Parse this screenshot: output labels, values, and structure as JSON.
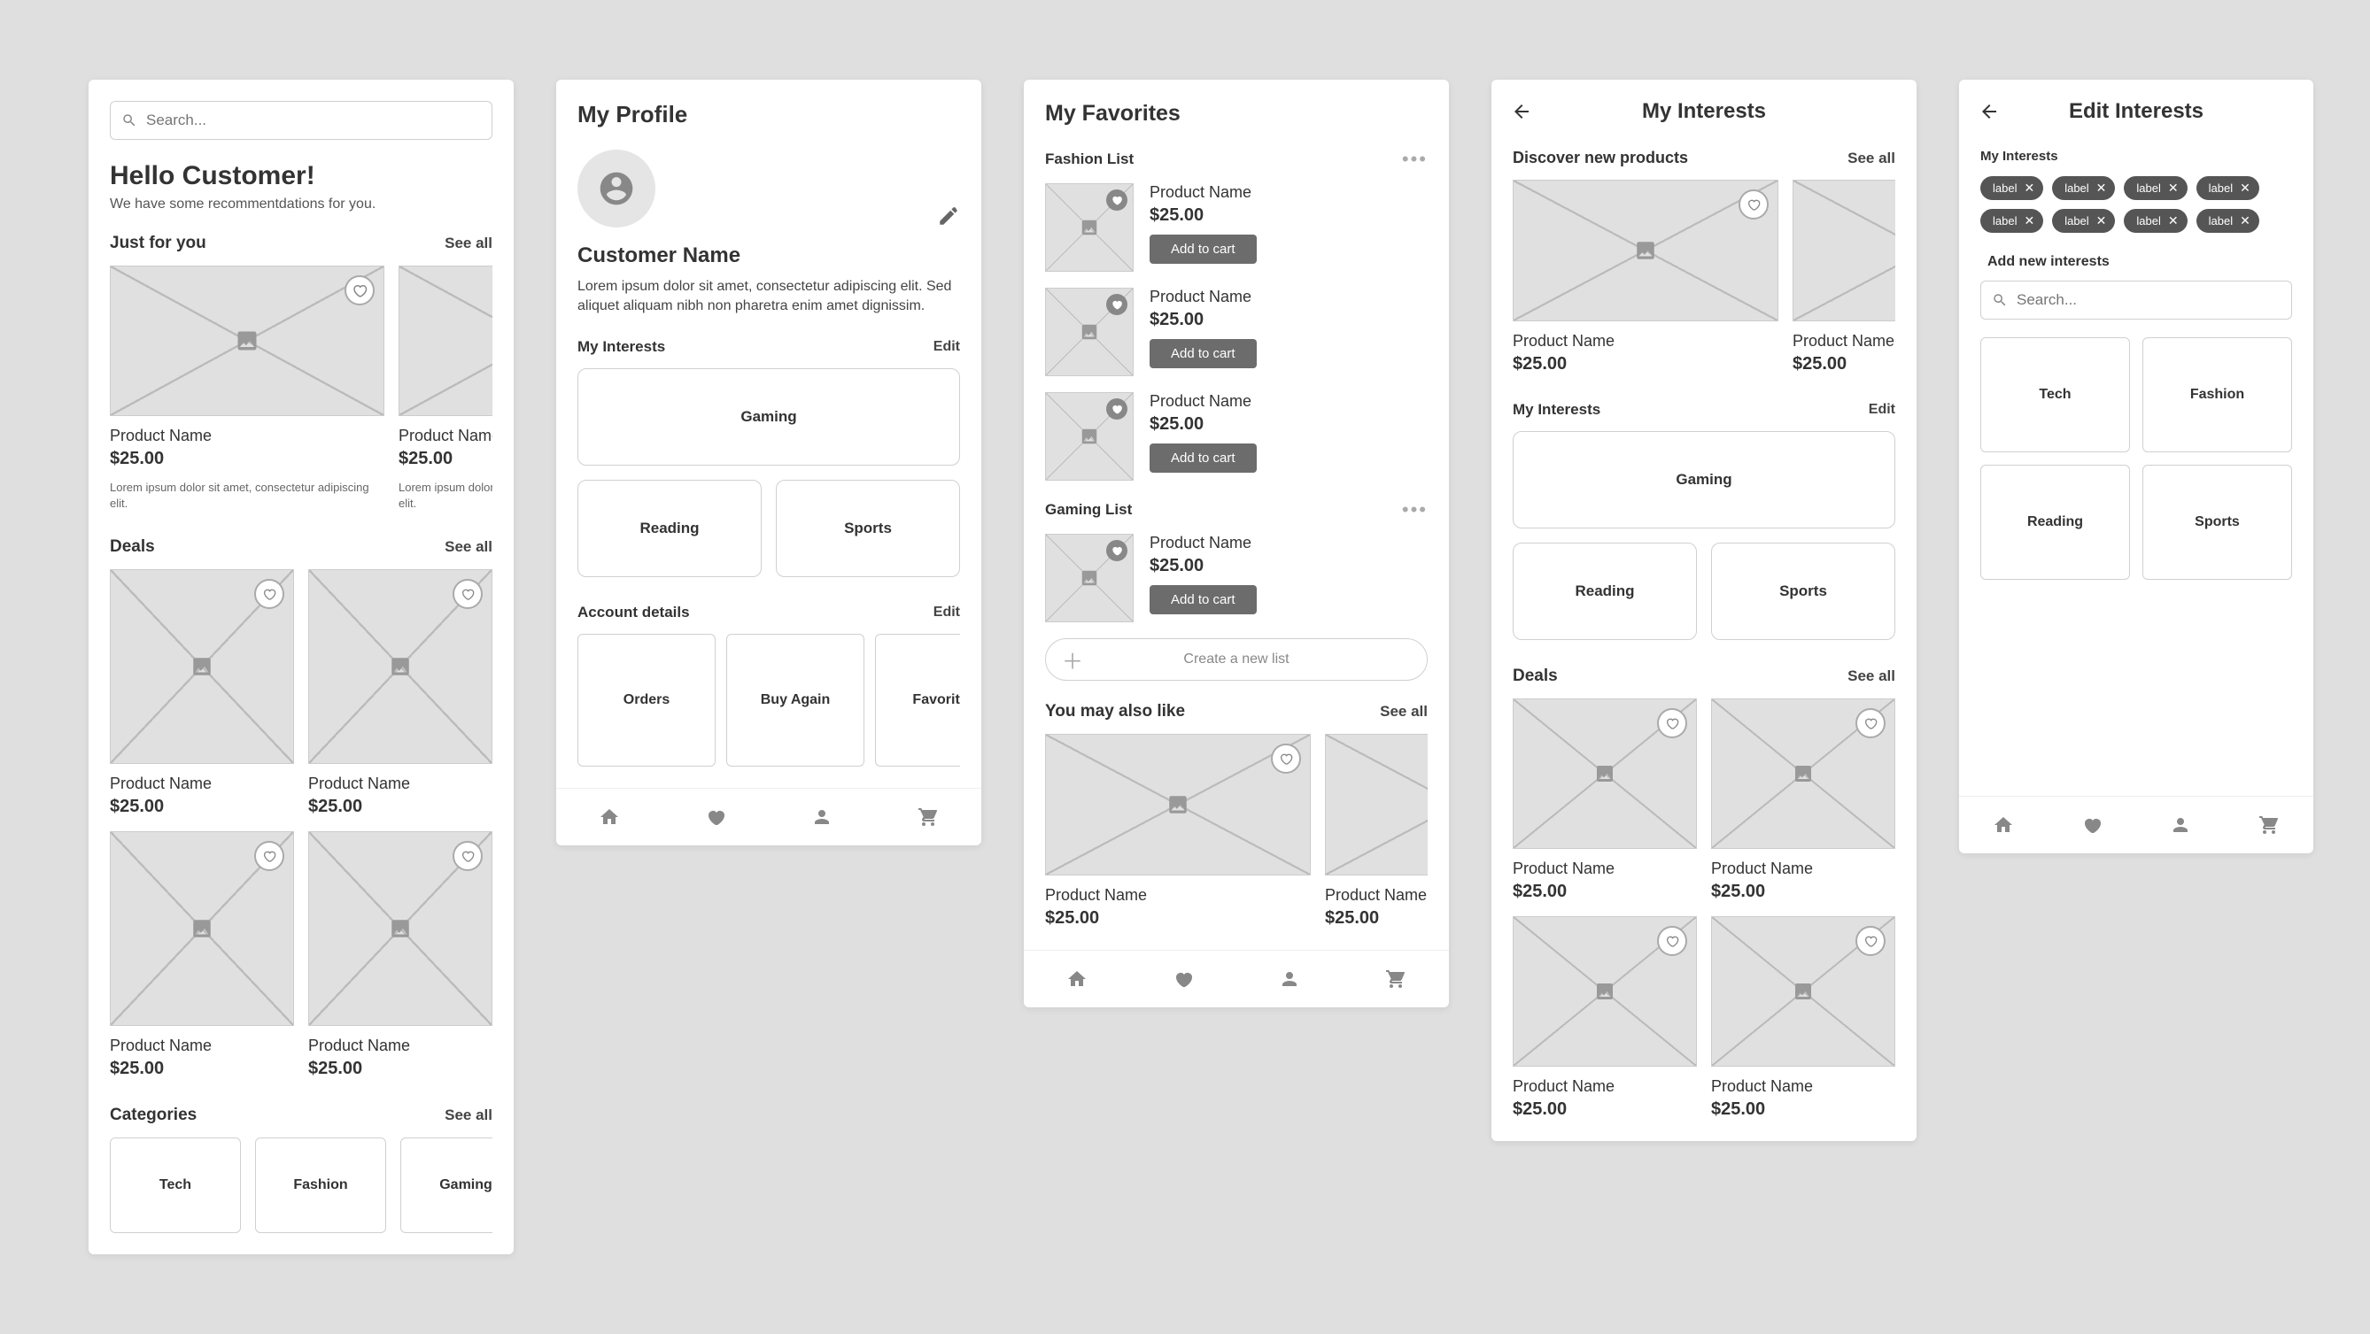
{
  "home": {
    "search_placeholder": "Search...",
    "greeting": "Hello Customer!",
    "subtitle": "We have some recommentdations for you.",
    "just_for_you": {
      "title": "Just for you",
      "see_all": "See all",
      "items": [
        {
          "name": "Product Name",
          "price": "$25.00",
          "desc": "Lorem ipsum dolor sit amet, consectetur adipiscing elit."
        },
        {
          "name": "Product Name",
          "price": "$25.00",
          "desc": "Lorem ipsum dolor sit amet, consectetur adipiscing elit."
        }
      ]
    },
    "deals": {
      "title": "Deals",
      "see_all": "See all",
      "items": [
        {
          "name": "Product Name",
          "price": "$25.00"
        },
        {
          "name": "Product Name",
          "price": "$25.00"
        },
        {
          "name": "Product Name",
          "price": "$25.00"
        },
        {
          "name": "Product Name",
          "price": "$25.00"
        }
      ]
    },
    "categories": {
      "title": "Categories",
      "see_all": "See all",
      "items": [
        "Tech",
        "Fashion",
        "Gaming"
      ]
    }
  },
  "profile": {
    "title": "My Profile",
    "name": "Customer Name",
    "bio": "Lorem ipsum dolor sit amet, consectetur adipiscing elit. Sed aliquet aliquam nibh non pharetra enim amet dignissim.",
    "interests": {
      "title": "My Interests",
      "edit": "Edit",
      "items": [
        "Gaming",
        "Reading",
        "Sports"
      ]
    },
    "account": {
      "title": "Account details",
      "edit": "Edit",
      "items": [
        "Orders",
        "Buy Again",
        "Favorites"
      ]
    }
  },
  "favorites": {
    "title": "My Favorites",
    "lists": [
      {
        "name": "Fashion List",
        "items": [
          {
            "name": "Product Name",
            "price": "$25.00",
            "cta": "Add to cart"
          },
          {
            "name": "Product Name",
            "price": "$25.00",
            "cta": "Add to cart"
          },
          {
            "name": "Product Name",
            "price": "$25.00",
            "cta": "Add to cart"
          }
        ]
      },
      {
        "name": "Gaming List",
        "items": [
          {
            "name": "Product Name",
            "price": "$25.00",
            "cta": "Add to cart"
          }
        ]
      }
    ],
    "create": "Create a new list",
    "also_like": {
      "title": "You may also like",
      "see_all": "See all",
      "items": [
        {
          "name": "Product Name",
          "price": "$25.00"
        },
        {
          "name": "Product Name",
          "price": "$25.00"
        }
      ]
    }
  },
  "interests": {
    "title": "My Interests",
    "discover": {
      "title": "Discover new products",
      "see_all": "See all",
      "items": [
        {
          "name": "Product Name",
          "price": "$25.00"
        },
        {
          "name": "Product Name",
          "price": "$25.00"
        }
      ]
    },
    "my": {
      "title": "My Interests",
      "edit": "Edit",
      "items": [
        "Gaming",
        "Reading",
        "Sports"
      ]
    },
    "deals": {
      "title": "Deals",
      "see_all": "See all",
      "items": [
        {
          "name": "Product Name",
          "price": "$25.00"
        },
        {
          "name": "Product Name",
          "price": "$25.00"
        },
        {
          "name": "Product Name",
          "price": "$25.00"
        },
        {
          "name": "Product Name",
          "price": "$25.00"
        }
      ]
    }
  },
  "edit_interests": {
    "title": "Edit Interests",
    "label": "My Interests",
    "chips": [
      "label",
      "label",
      "label",
      "label",
      "label",
      "label",
      "label",
      "label"
    ],
    "add_label": "Add new interests",
    "search_placeholder": "Search...",
    "tiles": [
      "Tech",
      "Fashion",
      "Reading",
      "Sports"
    ]
  }
}
